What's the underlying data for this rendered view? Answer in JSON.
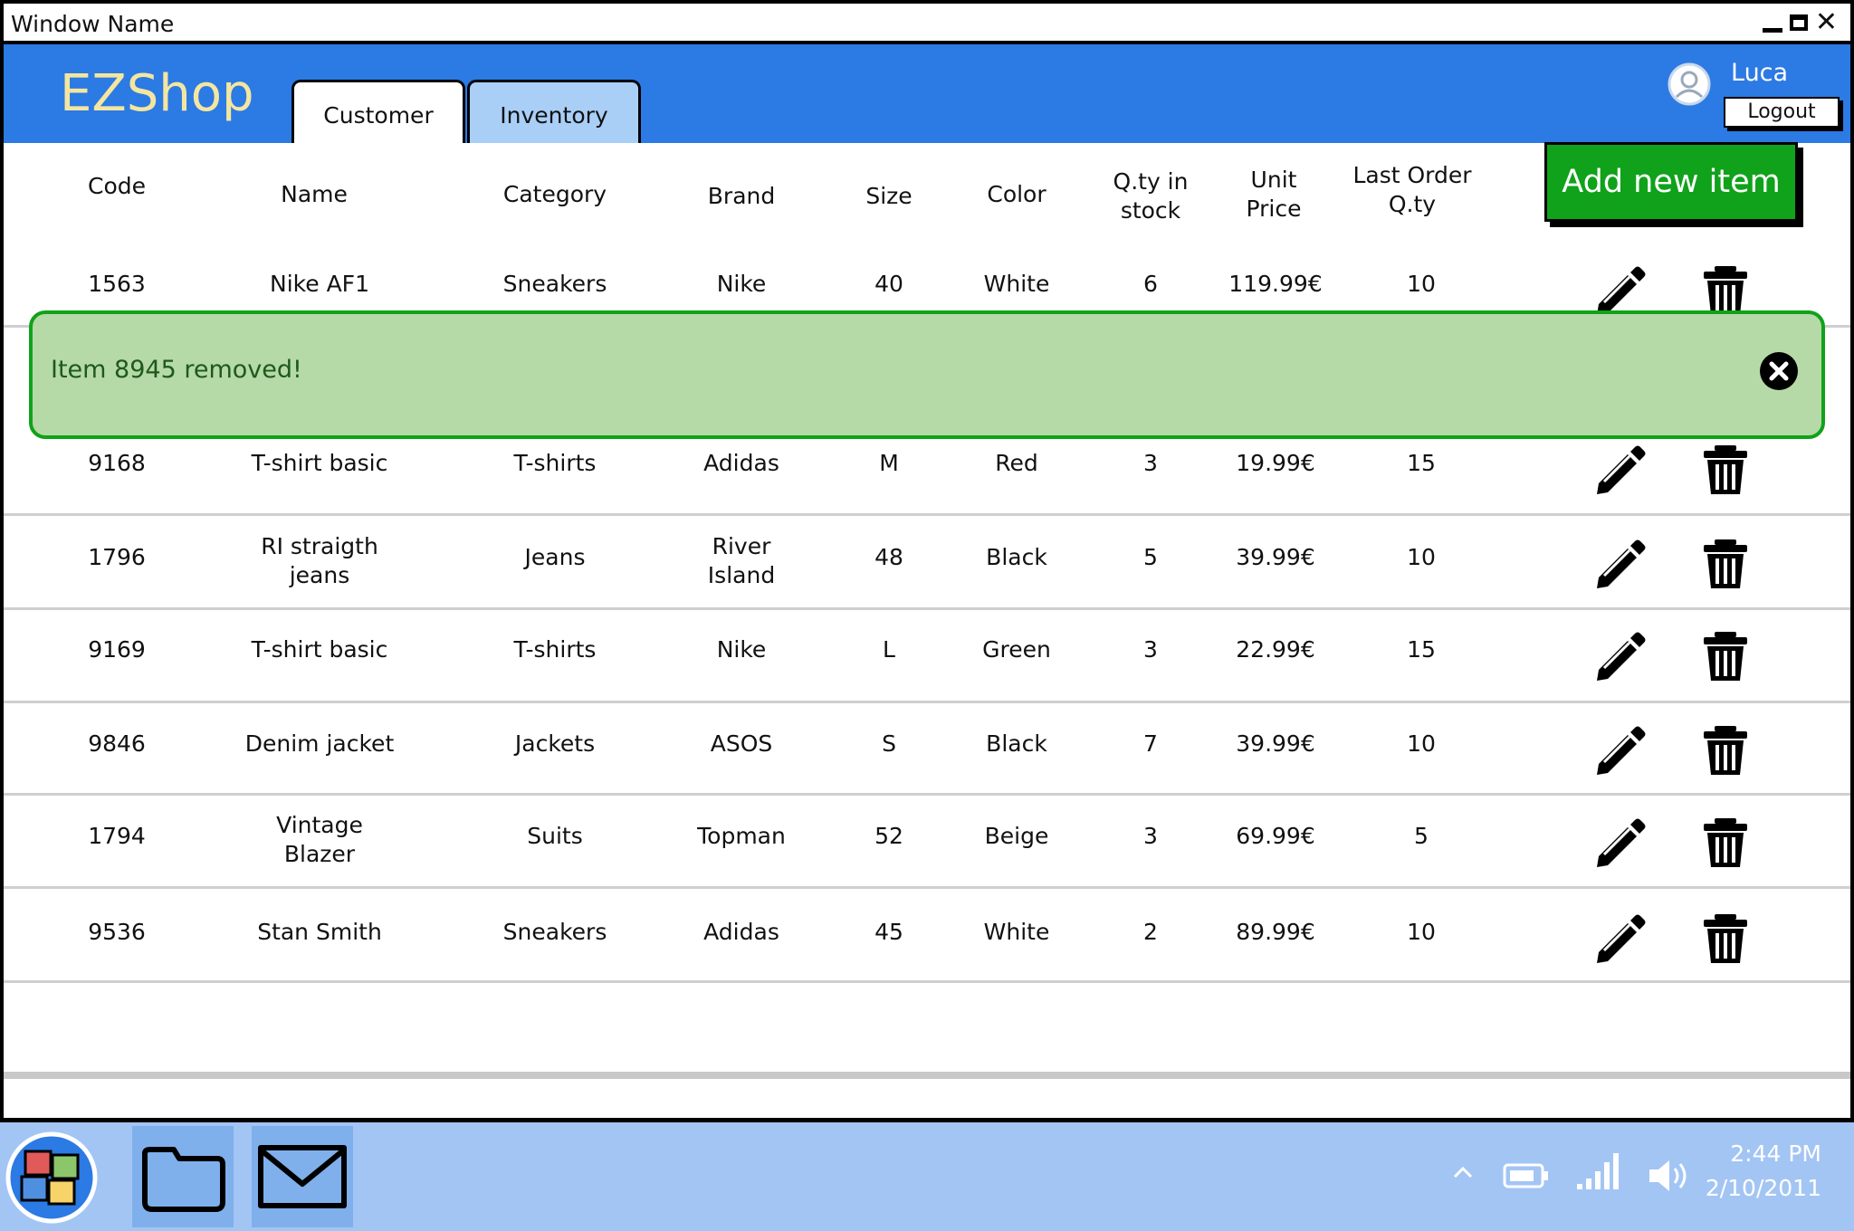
{
  "window": {
    "title": "Window Name"
  },
  "app": {
    "name": "EZShop"
  },
  "tabs": [
    {
      "label": "Customer",
      "active": true
    },
    {
      "label": "Inventory",
      "active": false
    }
  ],
  "user": {
    "name": "Luca",
    "logout_label": "Logout"
  },
  "actions": {
    "add_item_label": "Add new item"
  },
  "table": {
    "columns": {
      "code": "Code",
      "name": "Name",
      "category": "Category",
      "brand": "Brand",
      "size": "Size",
      "color": "Color",
      "qty_stock_1": "Q.ty in",
      "qty_stock_2": "stock",
      "unit_price_1": "Unit",
      "unit_price_2": "Price",
      "last_order_1": "Last Order",
      "last_order_2": "Q.ty"
    },
    "rows": [
      {
        "code": "1563",
        "name": "Nike AF1",
        "name2": "",
        "category": "Sneakers",
        "brand": "Nike",
        "brand2": "",
        "size": "40",
        "color": "White",
        "qty": "6",
        "price": "119.99€",
        "last": "10"
      },
      {
        "code": "9168",
        "name": "T-shirt basic",
        "name2": "",
        "category": "T-shirts",
        "brand": "Adidas",
        "brand2": "",
        "size": "M",
        "color": "Red",
        "qty": "3",
        "price": "19.99€",
        "last": "15"
      },
      {
        "code": "1796",
        "name": "RI straigth",
        "name2": "jeans",
        "category": "Jeans",
        "brand": "River",
        "brand2": "Island",
        "size": "48",
        "color": "Black",
        "qty": "5",
        "price": "39.99€",
        "last": "10"
      },
      {
        "code": "9169",
        "name": "T-shirt basic",
        "name2": "",
        "category": "T-shirts",
        "brand": "Nike",
        "brand2": "",
        "size": "L",
        "color": "Green",
        "qty": "3",
        "price": "22.99€",
        "last": "15"
      },
      {
        "code": "9846",
        "name": "Denim jacket",
        "name2": "",
        "category": "Jackets",
        "brand": "ASOS",
        "brand2": "",
        "size": "S",
        "color": "Black",
        "qty": "7",
        "price": "39.99€",
        "last": "10"
      },
      {
        "code": "1794",
        "name": "Vintage",
        "name2": "Blazer",
        "category": "Suits",
        "brand": "Topman",
        "brand2": "",
        "size": "52",
        "color": "Beige",
        "qty": "3",
        "price": "69.99€",
        "last": "5"
      },
      {
        "code": "9536",
        "name": "Stan Smith",
        "name2": "",
        "category": "Sneakers",
        "brand": "Adidas",
        "brand2": "",
        "size": "45",
        "color": "White",
        "qty": "2",
        "price": "89.99€",
        "last": "10"
      }
    ]
  },
  "notification": {
    "message": "Item 8945 removed!"
  },
  "taskbar": {
    "time": "2:44 PM",
    "date": "2/10/2011"
  },
  "icons": {
    "edit": "pencil-icon",
    "delete": "trash-icon",
    "close": "close-circle-icon",
    "user": "user-avatar-icon",
    "start": "start-menu-icon",
    "folder": "folder-icon",
    "mail": "mail-icon",
    "battery": "battery-icon",
    "signal": "signal-icon",
    "volume": "volume-icon",
    "chevron": "chevron-up-icon"
  },
  "colors": {
    "header": "#2c7ae3",
    "logo": "#f4e6a0",
    "add_button": "#10a21a",
    "toast_bg": "#b6d9a8",
    "toast_border": "#10a21a",
    "taskbar": "#a3c5f4"
  }
}
